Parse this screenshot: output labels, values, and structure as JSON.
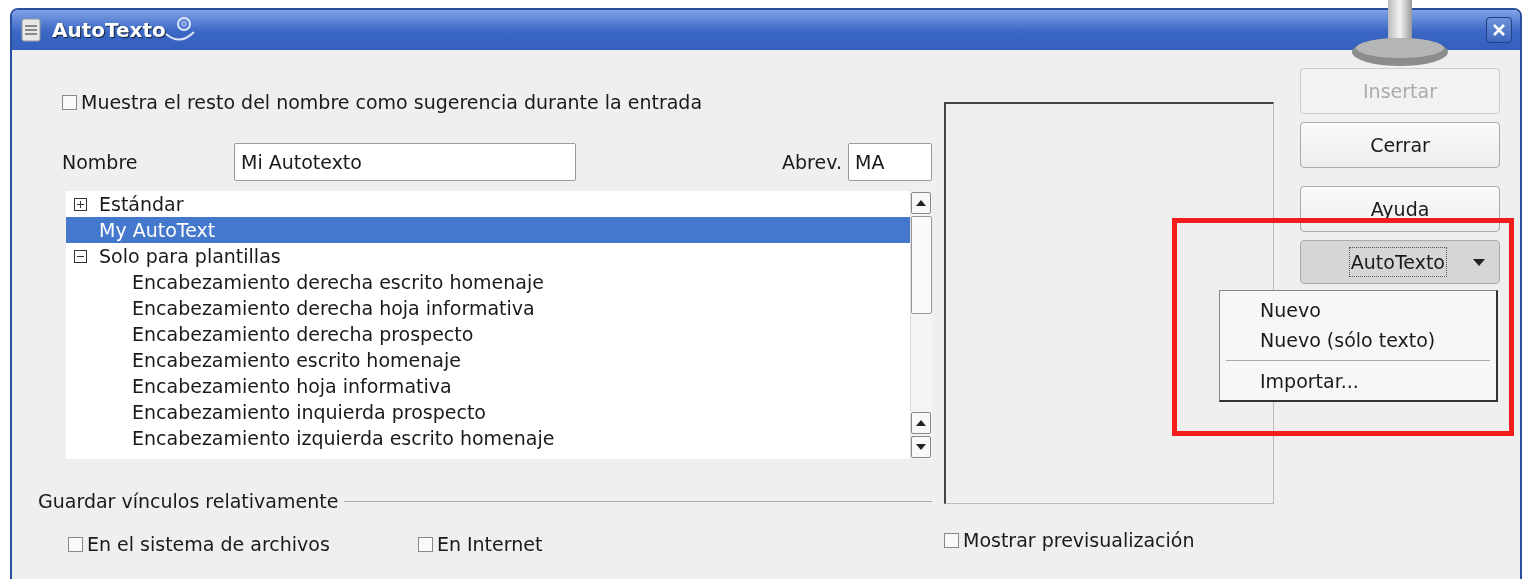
{
  "window": {
    "title": "AutoTexto"
  },
  "suggest_checkbox": {
    "label": "Muestra el resto del nombre como sugerencia durante la entrada",
    "checked": false
  },
  "name_field": {
    "label": "Nombre",
    "value": "Mi Autotexto"
  },
  "abbrev_field": {
    "label": "Abrev.",
    "value": "MA"
  },
  "tree": [
    {
      "label": "Estándar",
      "expanded": false,
      "selected": false
    },
    {
      "label": "My AutoText",
      "selected": true
    },
    {
      "label": "Solo para plantillas",
      "expanded": true,
      "selected": false,
      "children": [
        {
          "label": "Encabezamiento derecha escrito homenaje",
          "selected": false
        },
        {
          "label": "Encabezamiento derecha hoja informativa",
          "selected": false
        },
        {
          "label": "Encabezamiento derecha prospecto",
          "selected": false
        },
        {
          "label": "Encabezamiento escrito homenaje",
          "selected": false
        },
        {
          "label": "Encabezamiento hoja informativa",
          "selected": false
        },
        {
          "label": "Encabezamiento inquierda prospecto",
          "selected": false
        },
        {
          "label": "Encabezamiento izquierda escrito homenaje",
          "selected": false
        }
      ]
    }
  ],
  "links_group": {
    "title": "Guardar vínculos relativamente",
    "options": [
      {
        "label": "En el sistema de archivos",
        "checked": false
      },
      {
        "label": "En Internet",
        "checked": false
      }
    ]
  },
  "preview_checkbox": {
    "label": "Mostrar previsualización",
    "checked": false
  },
  "buttons": [
    {
      "label": "Insertar",
      "disabled": true
    },
    {
      "label": "Cerrar",
      "disabled": false
    },
    {
      "label": "Ayuda",
      "disabled": false
    }
  ],
  "menu_button": {
    "label": "AutoTexto",
    "expanded": true
  },
  "menu": [
    {
      "kind": "item",
      "label": "Nuevo"
    },
    {
      "kind": "item",
      "label": "Nuevo (sólo texto)"
    },
    {
      "kind": "separator"
    },
    {
      "kind": "item",
      "label": "Importar..."
    }
  ]
}
